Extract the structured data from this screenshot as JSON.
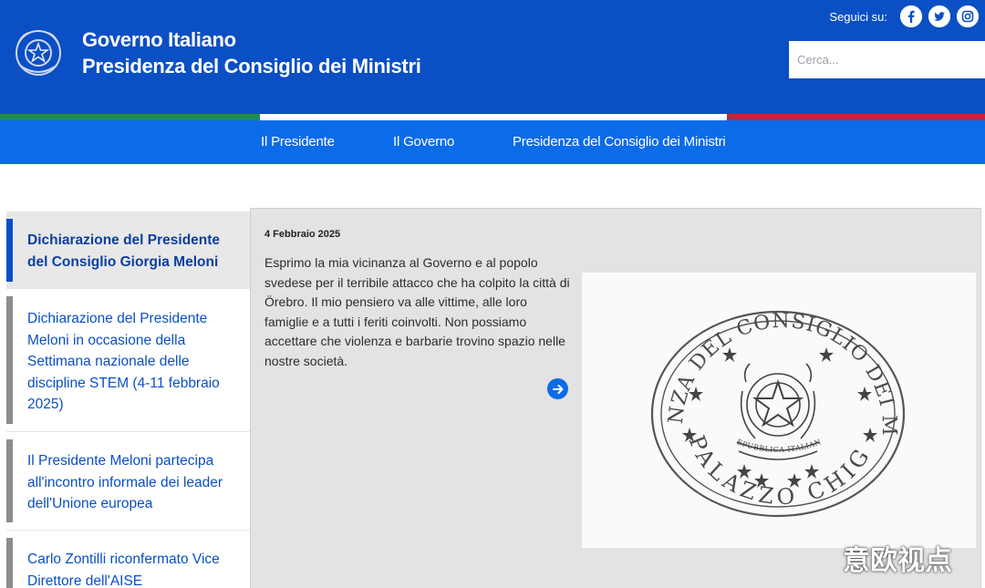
{
  "header": {
    "title_line1": "Governo Italiano",
    "title_line2": "Presidenza del Consiglio dei Ministri",
    "follow_label": "Seguici su:",
    "social_icons": [
      "facebook-icon",
      "twitter-icon",
      "instagram-icon"
    ],
    "search_placeholder": "Cerca..."
  },
  "nav": {
    "items": [
      {
        "label": "Il Presidente"
      },
      {
        "label": "Il Governo"
      },
      {
        "label": "Presidenza del Consiglio dei Ministri"
      }
    ]
  },
  "sidebar": {
    "items": [
      {
        "label": "Dichiarazione del Presidente del Consiglio Giorgia Meloni",
        "active": true
      },
      {
        "label": "Dichiarazione del Presidente Meloni in occasione della Settimana nazionale delle discipline STEM (4-11 febbraio 2025)"
      },
      {
        "label": "Il Presidente Meloni partecipa all'incontro informale dei leader dell'Unione europea"
      },
      {
        "label": "Carlo Zontilli riconfermato Vice Direttore dell'AISE"
      }
    ]
  },
  "article": {
    "date": "4 Febbraio 2025",
    "text": "Esprimo la mia vicinanza al Governo e al popolo svedese per il terribile attacco che ha colpito la città di Örebro. Il mio pensiero va alle vittime, alle loro famiglie e a tutti i feriti coinvolti. Non possiamo accettare che violenza e barbarie trovino spazio nelle nostre società."
  },
  "seal": {
    "top_text": "PRESIDENZA DEL CONSIGLIO DEI MINISTRI",
    "bottom_text": "PALAZZO CHIGI",
    "ribbon_text": "REPUBBLICA ITALIANA"
  },
  "watermark": "意欧视点",
  "colors": {
    "header_blue": "#0b4fc4",
    "nav_blue": "#0c6be8",
    "tricolor_green": "#1f8f43",
    "tricolor_red": "#c1272d"
  }
}
